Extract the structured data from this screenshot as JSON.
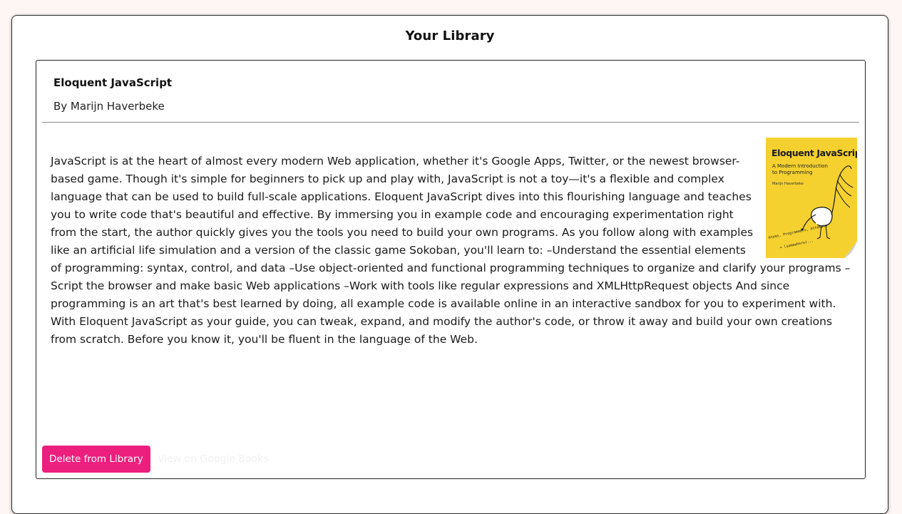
{
  "page": {
    "title": "Your Library"
  },
  "book": {
    "title": "Eloquent JavaScript",
    "author_line": "By Marijn Haverbeke",
    "description": "JavaScript is at the heart of almost every modern Web application, whether it's Google Apps, Twitter, or the newest browser-based game. Though it's simple for beginners to pick up and play with, JavaScript is not a toy—it's a flexible and complex language that can be used to build full-scale applications. Eloquent JavaScript dives into this flourishing language and teaches you to write code that's beautiful and effective. By immersing you in example code and encouraging experimentation right from the start, the author quickly gives you the tools you need to build your own programs. As you follow along with examples like an artificial life simulation and a version of the classic game Sokoban, you'll learn to: –Understand the essential elements of programming: syntax, control, and data –Use object-oriented and functional programming techniques to organize and clarify your programs –Script the browser and make basic Web applications –Work with tools like regular expressions and XMLHttpRequest objects And since programming is an art that's best learned by doing, all example code is available online in an interactive sandbox for you to experiment with. With Eloquent JavaScript as your guide, you can tweak, expand, and modify the author's code, or throw it away and build your own creations from scratch. Before you know it, you'll be fluent in the language of the Web.",
    "cover": {
      "title": "Eloquent JavaScript",
      "subtitle": "A Modern Introduction to Programming",
      "author": "Marijn Haverbeke",
      "background_color": "#f5d130"
    }
  },
  "actions": {
    "delete_label": "Delete from Library",
    "google_label": "View on Google Books"
  },
  "colors": {
    "accent": "#ec1f7e",
    "page_background": "#fdf6f5"
  }
}
